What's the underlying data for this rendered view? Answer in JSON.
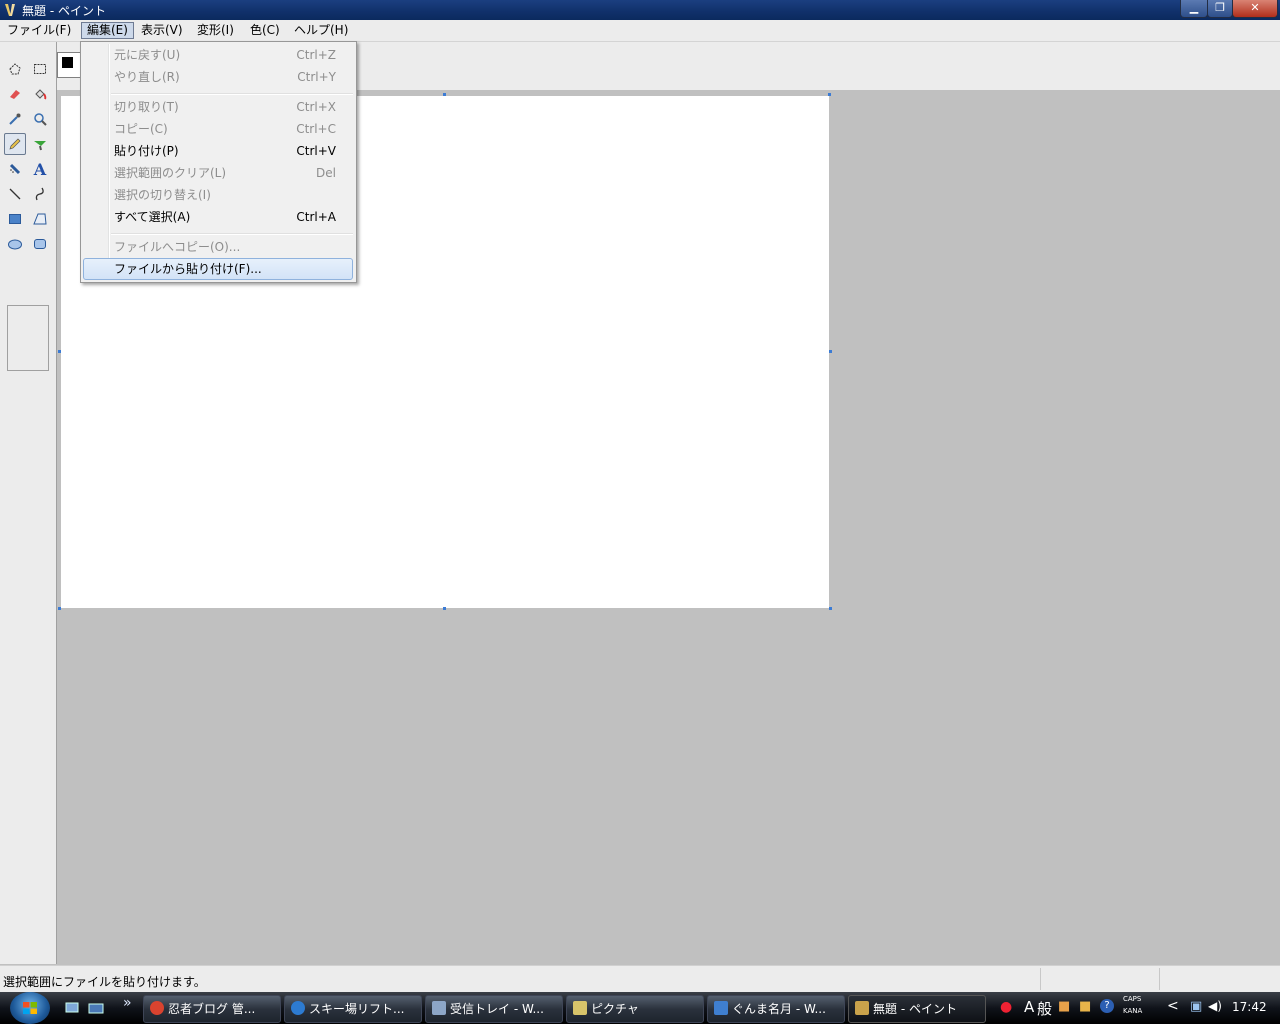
{
  "window": {
    "title": "無題 - ペイント",
    "buttons": {
      "minimize": "▁",
      "maximize": "❐",
      "close": "✕"
    }
  },
  "menubar": [
    {
      "label": "ファイル(F)"
    },
    {
      "label": "編集(E)",
      "active": true
    },
    {
      "label": "表示(V)"
    },
    {
      "label": "変形(I)"
    },
    {
      "label": "色(C)"
    },
    {
      "label": "ヘルプ(H)"
    }
  ],
  "edit_menu": {
    "items": [
      {
        "label": "元に戻す(U)",
        "shortcut": "Ctrl+Z",
        "disabled": true
      },
      {
        "label": "やり直し(R)",
        "shortcut": "Ctrl+Y",
        "disabled": true
      },
      {
        "label": "切り取り(T)",
        "shortcut": "Ctrl+X",
        "disabled": true
      },
      {
        "label": "コピー(C)",
        "shortcut": "Ctrl+C",
        "disabled": true
      },
      {
        "label": "貼り付け(P)",
        "shortcut": "Ctrl+V",
        "disabled": false
      },
      {
        "label": "選択範囲のクリア(L)",
        "shortcut": "Del",
        "disabled": true
      },
      {
        "label": "選択の切り替え(I)",
        "shortcut": "",
        "disabled": true
      },
      {
        "label": "すべて選択(A)",
        "shortcut": "Ctrl+A",
        "disabled": false
      },
      {
        "label": "ファイルへコピー(O)...",
        "shortcut": "",
        "disabled": true
      },
      {
        "label": "ファイルから貼り付け(F)...",
        "shortcut": "",
        "disabled": false,
        "hover": true
      }
    ]
  },
  "tools": [
    "free-select-icon",
    "rect-select-icon",
    "eraser-icon",
    "fill-icon",
    "eyedropper-icon",
    "magnifier-icon",
    "pencil-icon",
    "brush-icon",
    "airbrush-icon",
    "text-icon",
    "line-icon",
    "curve-icon",
    "rectangle-icon",
    "polygon-icon",
    "ellipse-icon",
    "rounded-rect-icon"
  ],
  "text_tool_glyph": "A",
  "status": {
    "text": "選択範囲にファイルを貼り付けます。"
  },
  "taskbar": {
    "quicklaunch_more": "»",
    "tasks": [
      {
        "label": "忍者ブログ 管...",
        "color": "#d9432f"
      },
      {
        "label": "スキー場リフト...",
        "color": "#2d7bd1"
      },
      {
        "label": "受信トレイ - W...",
        "color": "#8da6c7"
      },
      {
        "label": "ピクチャ",
        "color": "#d8c46a"
      },
      {
        "label": "ぐんま名月 - W...",
        "color": "#3f7fd0"
      },
      {
        "label": "無題 - ペイント",
        "color": "#c9a24b",
        "active": true
      }
    ],
    "tray": {
      "ime_mode": "A",
      "ime_kanji": "般",
      "help": "?",
      "caps": "CAPS",
      "kana": "KANA",
      "arrow": "<"
    },
    "clock": "17:42"
  },
  "colors": {
    "foreground": "#000000",
    "background": "#ffffff",
    "selection_handle": "#3b7bd4"
  }
}
